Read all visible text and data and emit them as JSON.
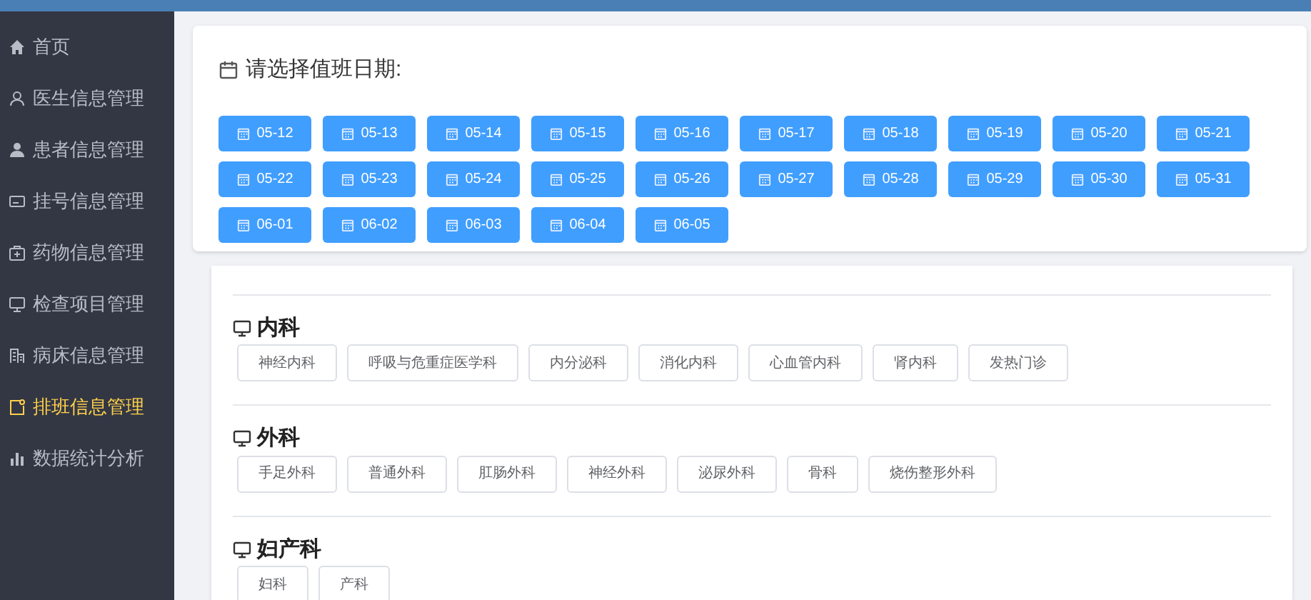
{
  "sidebar": {
    "items": [
      {
        "label": "首页",
        "selected": false
      },
      {
        "label": "医生信息管理",
        "selected": false
      },
      {
        "label": "患者信息管理",
        "selected": false
      },
      {
        "label": "挂号信息管理",
        "selected": false
      },
      {
        "label": "药物信息管理",
        "selected": false
      },
      {
        "label": "检查项目管理",
        "selected": false
      },
      {
        "label": "病床信息管理",
        "selected": false
      },
      {
        "label": "排班信息管理",
        "selected": true
      },
      {
        "label": "数据统计分析",
        "selected": false
      }
    ]
  },
  "date_picker": {
    "title": "请选择值班日期:",
    "dates": [
      "05-12",
      "05-13",
      "05-14",
      "05-15",
      "05-16",
      "05-17",
      "05-18",
      "05-19",
      "05-20",
      "05-21",
      "05-22",
      "05-23",
      "05-24",
      "05-25",
      "05-26",
      "05-27",
      "05-28",
      "05-29",
      "05-30",
      "05-31",
      "06-01",
      "06-02",
      "06-03",
      "06-04",
      "06-05"
    ]
  },
  "departments": [
    {
      "name": "内科",
      "clinics": [
        "神经内科",
        "呼吸与危重症医学科",
        "内分泌科",
        "消化内科",
        "心血管内科",
        "肾内科",
        "发热门诊"
      ]
    },
    {
      "name": "外科",
      "clinics": [
        "手足外科",
        "普通外科",
        "肛肠外科",
        "神经外科",
        "泌尿外科",
        "骨科",
        "烧伤整形外科"
      ]
    },
    {
      "name": "妇产科",
      "clinics": [
        "妇科",
        "产科"
      ]
    }
  ]
}
